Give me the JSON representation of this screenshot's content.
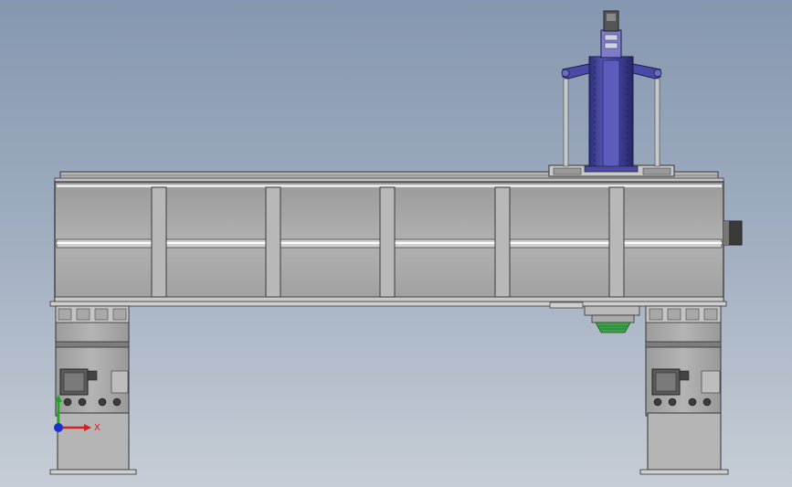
{
  "view": {
    "background_top": "#8597b0",
    "background_bottom": "#c6cdd6"
  },
  "triad": {
    "x_label": "X",
    "x_color": "#d62020",
    "y_color": "#1ea81e",
    "z_color": "#2030d0"
  },
  "colors": {
    "frame_gray": "#a3a3a3",
    "spindle_blue": "#4a4aa6",
    "edge_dark": "#3a3a3a",
    "tool_green": "#3aa34a"
  },
  "icons": {
    "triad": "coordinate-triad-icon"
  }
}
